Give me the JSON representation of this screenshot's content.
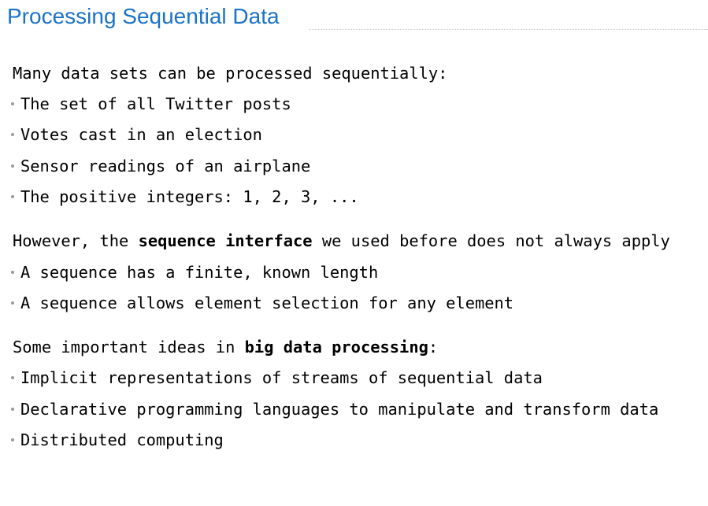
{
  "title": "Processing Sequential Data",
  "section1": {
    "heading": "Many data sets can be processed sequentially:",
    "items": [
      "The set of all Twitter posts",
      "Votes cast in an election",
      "Sensor readings of an airplane",
      "The positive integers: 1, 2, 3, ..."
    ]
  },
  "section2": {
    "heading_before": "However, the ",
    "heading_bold": "sequence interface",
    "heading_after": " we used before does not always apply",
    "items": [
      "A sequence has a finite, known length",
      "A sequence allows element selection for any element"
    ]
  },
  "section3": {
    "heading_before": "Some important ideas in ",
    "heading_bold": "big data processing",
    "heading_after": ":",
    "items": [
      "Implicit representations of streams of sequential data",
      "Declarative programming languages to manipulate and transform data",
      "Distributed computing"
    ]
  }
}
